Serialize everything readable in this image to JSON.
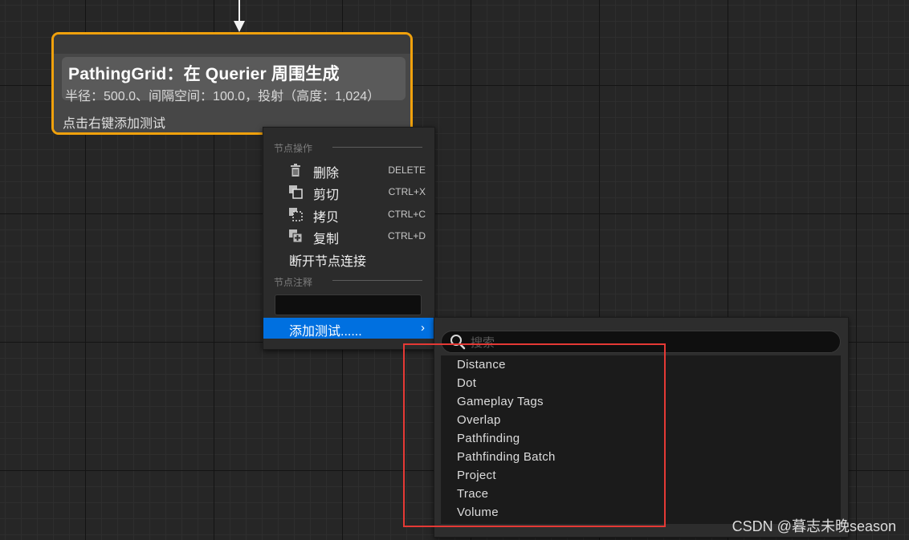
{
  "node": {
    "title": "PathingGrid：在 Querier 周围生成",
    "subtitle": "半径：500.0、间隔空间：100.0，投射（高度：1,024）",
    "hint": "点击右键添加测试"
  },
  "context_menu": {
    "section_node_actions": "节点操作",
    "items": [
      {
        "label": "删除",
        "shortcut": "DELETE",
        "icon": "trash-icon"
      },
      {
        "label": "剪切",
        "shortcut": "CTRL+X",
        "icon": "cut-icon"
      },
      {
        "label": "拷贝",
        "shortcut": "CTRL+C",
        "icon": "copy-icon"
      },
      {
        "label": "复制",
        "shortcut": "CTRL+D",
        "icon": "duplicate-icon"
      }
    ],
    "break_links_label": "断开节点连接",
    "section_node_comment": "节点注释",
    "add_test_label": "添加测试......",
    "add_test_arrow": "›"
  },
  "submenu": {
    "search_placeholder": "搜索",
    "items": [
      "Distance",
      "Dot",
      "Gameplay Tags",
      "Overlap",
      "Pathfinding",
      "Pathfinding Batch",
      "Project",
      "Trace",
      "Volume"
    ]
  },
  "watermark": "CSDN @暮志未晚season",
  "colors": {
    "node_border": "#f0a10c",
    "menu_highlight": "#0070e0",
    "annotation_box": "#e53935"
  }
}
